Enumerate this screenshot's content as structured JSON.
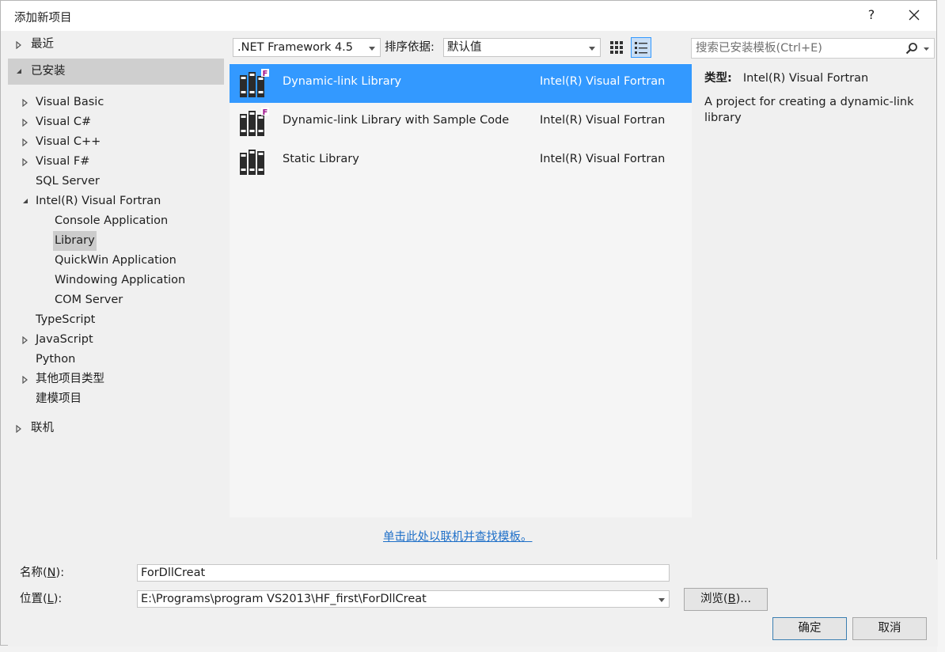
{
  "window": {
    "title": "添加新项目",
    "help_label": "?"
  },
  "tree": {
    "recent": "最近",
    "installed": "已安装",
    "items": [
      "Visual Basic",
      "Visual C#",
      "Visual C++",
      "Visual F#",
      "SQL Server",
      "Intel(R) Visual Fortran",
      "Console Application",
      "Library",
      "QuickWin Application",
      "Windowing Application",
      "COM Server",
      "TypeScript",
      "JavaScript",
      "Python",
      "其他项目类型",
      "建模项目"
    ],
    "online": "联机"
  },
  "toolbar": {
    "framework": ".NET Framework 4.5",
    "sort_label": "排序依据:",
    "sort_value": "默认值",
    "search_placeholder": "搜索已安装模板(Ctrl+E)"
  },
  "templates": [
    {
      "name": "Dynamic-link Library",
      "language": "Intel(R) Visual Fortran"
    },
    {
      "name": "Dynamic-link Library with Sample Code",
      "language": "Intel(R) Visual Fortran"
    },
    {
      "name": "Static Library",
      "language": "Intel(R) Visual Fortran"
    }
  ],
  "details": {
    "type_label": "类型:",
    "type_value": "Intel(R) Visual Fortran",
    "description": "A project for creating a dynamic-link library"
  },
  "online_link": "单击此处以联机并查找模板。",
  "form": {
    "name_label_pre": "名称(",
    "name_label_key": "N",
    "name_label_post": "):",
    "name_value": "ForDllCreat",
    "location_label_pre": "位置(",
    "location_label_key": "L",
    "location_label_post": "):",
    "location_value": "E:\\Programs\\program VS2013\\HF_first\\ForDllCreat",
    "browse_pre": "浏览(",
    "browse_key": "B",
    "browse_post": ")...",
    "ok": "确定",
    "cancel": "取消"
  },
  "colors": {
    "selection": "#3399ff",
    "link": "#1e6fc8",
    "fortran_badge": "#a0148c"
  }
}
